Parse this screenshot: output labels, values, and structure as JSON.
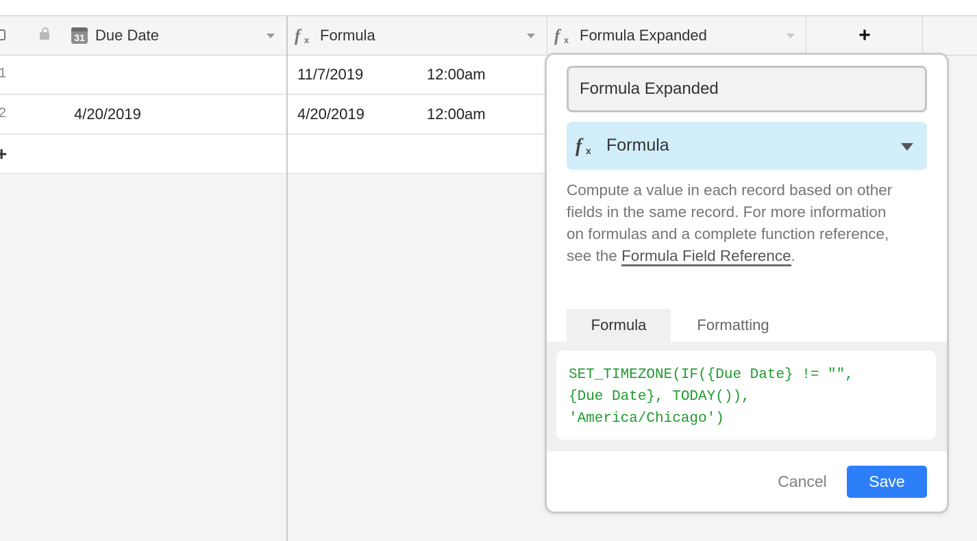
{
  "columns": {
    "due_date": {
      "label": "Due Date",
      "icon": "calendar-icon",
      "icon_text": "31"
    },
    "formula": {
      "label": "Formula",
      "icon": "formula-fx-icon"
    },
    "formula_expanded": {
      "label": "Formula Expanded",
      "icon": "formula-fx-icon"
    },
    "add_field": {
      "label": "+"
    }
  },
  "rows": [
    {
      "number": "1",
      "due_date": "",
      "formula_date": "11/7/2019",
      "formula_time": "12:00am"
    },
    {
      "number": "2",
      "due_date": "4/20/2019",
      "formula_date": "4/20/2019",
      "formula_time": "12:00am"
    }
  ],
  "add_row_label": "+",
  "field_editor": {
    "name_value": "Formula Expanded",
    "type_label": "Formula",
    "description_prefix": "Compute a value in each record based on other fields in the same record. For more information on formulas and a complete function reference, see the ",
    "description_link": "Formula Field Reference",
    "description_suffix": ".",
    "tabs": [
      {
        "label": "Formula",
        "active": true
      },
      {
        "label": "Formatting",
        "active": false
      }
    ],
    "formula_text": "SET_TIMEZONE(IF({Due Date} != \"\",\n{Due Date}, TODAY()),\n'America/Chicago')",
    "cancel_label": "Cancel",
    "save_label": "Save"
  },
  "colors": {
    "accent": "#2d7ff9",
    "type_select_bg": "#d1eefa",
    "formula_text": "#1f9b2e"
  }
}
